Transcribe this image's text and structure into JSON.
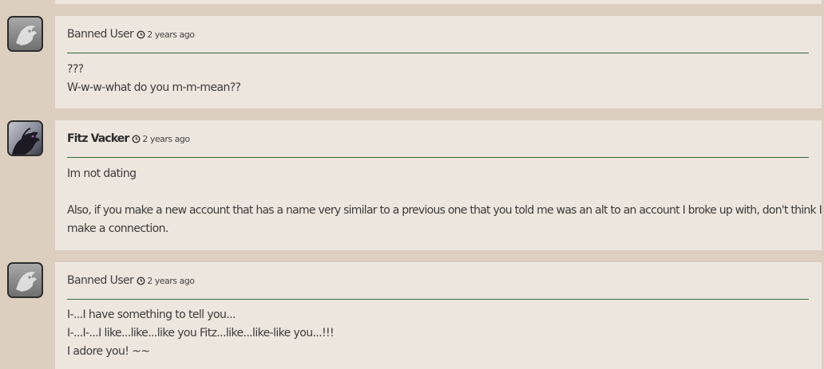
{
  "comments": [
    {
      "author": "Banned User",
      "time": "2 years ago",
      "avatar_icon": "ghost-dragon-avatar-icon",
      "lines": [
        "???",
        "W-w-w-what do you m-m-mean??"
      ]
    },
    {
      "author": "Fitz Vacker",
      "time": "2 years ago",
      "avatar_icon": "black-dragon-avatar-icon",
      "lines": [
        "Im not dating",
        "Also, if you make a new account that has a name very similar to a previous one that you told me was an alt to an account I broke up with, don't think I won't",
        "make a connection."
      ]
    },
    {
      "author": "Banned User",
      "time": "2 years ago",
      "avatar_icon": "ghost-dragon-avatar-icon",
      "lines": [
        "I-...I have something to tell you...",
        "I-...I-...I like...like...like you Fitz...like...like-like you...!!!",
        "I adore you! ~~"
      ]
    }
  ],
  "colors": {
    "page_bg": "#dccfbf",
    "card_bg": "#ede6de",
    "divider": "#2e6b3a"
  }
}
